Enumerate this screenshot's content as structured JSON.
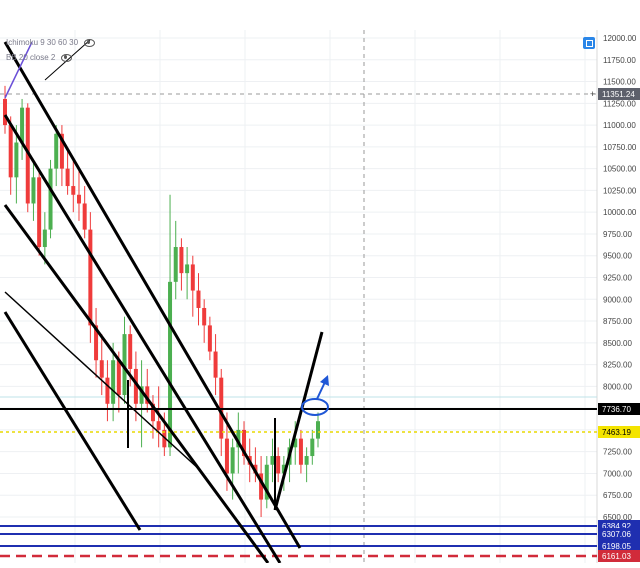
{
  "legend": {
    "ichimoku": "Ichimoku 9 30 60 30",
    "bb": "BB 20 close 2"
  },
  "crosshair_label": "11351.24",
  "chart_data": {
    "type": "candlestick",
    "y_ticks": [
      12000,
      11750,
      11500,
      11250,
      11000,
      10750,
      10500,
      10250,
      10000,
      9750,
      9500,
      9250,
      9000,
      8750,
      8500,
      8250,
      8000,
      7750,
      7500,
      7250,
      7000,
      6750,
      6500
    ],
    "ylim": [
      6150,
      12050
    ],
    "grid": true,
    "price_lines": [
      {
        "label": "7736.70",
        "color": "#000000"
      },
      {
        "label": "7463.19",
        "color": "#e8d800"
      },
      {
        "label": "6384.92",
        "color": "#1f2fb0"
      },
      {
        "label": "6307.06",
        "color": "#1f2fb0"
      },
      {
        "label": "6198.05",
        "color": "#1f2fb0"
      },
      {
        "label": "6161.03",
        "color": "#d12b3a"
      }
    ],
    "candles": [
      [
        11300,
        11450,
        10900,
        11000
      ],
      [
        11000,
        11100,
        10200,
        10400
      ],
      [
        10400,
        11000,
        10100,
        10800
      ],
      [
        10800,
        11300,
        10600,
        11200
      ],
      [
        11200,
        11250,
        10000,
        10100
      ],
      [
        10100,
        10600,
        9900,
        10400
      ],
      [
        10400,
        10500,
        9500,
        9600
      ],
      [
        9600,
        10000,
        9400,
        9800
      ],
      [
        9800,
        10600,
        9700,
        10500
      ],
      [
        10500,
        11000,
        10300,
        10900
      ],
      [
        10900,
        11000,
        10300,
        10500
      ],
      [
        10500,
        10700,
        10200,
        10300
      ],
      [
        10300,
        10600,
        10000,
        10200
      ],
      [
        10200,
        10500,
        9900,
        10100
      ],
      [
        10100,
        10300,
        9700,
        9800
      ],
      [
        9800,
        10000,
        8500,
        8700
      ],
      [
        8700,
        8900,
        8100,
        8300
      ],
      [
        8300,
        8600,
        7900,
        8100
      ],
      [
        8100,
        8300,
        7600,
        7800
      ],
      [
        7800,
        8500,
        7600,
        8300
      ],
      [
        8300,
        8400,
        7700,
        7900
      ],
      [
        7900,
        8800,
        7800,
        8600
      ],
      [
        8600,
        8700,
        8000,
        8200
      ],
      [
        8200,
        8400,
        7600,
        7800
      ],
      [
        7800,
        8300,
        7300,
        8000
      ],
      [
        8000,
        8200,
        7700,
        7800
      ],
      [
        7800,
        7900,
        7400,
        7600
      ],
      [
        7600,
        8000,
        7300,
        7500
      ],
      [
        7500,
        7700,
        7200,
        7300
      ],
      [
        7300,
        10200,
        7200,
        9200
      ],
      [
        9200,
        9900,
        9000,
        9600
      ],
      [
        9600,
        9700,
        9100,
        9300
      ],
      [
        9300,
        9600,
        9000,
        9400
      ],
      [
        9400,
        9500,
        8800,
        9100
      ],
      [
        9100,
        9300,
        8700,
        8900
      ],
      [
        8900,
        9000,
        8500,
        8700
      ],
      [
        8700,
        8800,
        8300,
        8400
      ],
      [
        8400,
        8600,
        7900,
        8100
      ],
      [
        8100,
        8200,
        7200,
        7400
      ],
      [
        7400,
        7700,
        6800,
        7000
      ],
      [
        7000,
        7400,
        6700,
        7300
      ],
      [
        7300,
        7700,
        7000,
        7500
      ],
      [
        7500,
        7600,
        7100,
        7200
      ],
      [
        7200,
        7400,
        6900,
        7100
      ],
      [
        7100,
        7300,
        6900,
        7000
      ],
      [
        7000,
        7200,
        6500,
        6700
      ],
      [
        6700,
        7200,
        6600,
        7100
      ],
      [
        7100,
        7400,
        6900,
        7200
      ],
      [
        7200,
        7300,
        6900,
        7000
      ],
      [
        7000,
        7200,
        6800,
        7100
      ],
      [
        7100,
        7400,
        6900,
        7300
      ],
      [
        7300,
        7600,
        7100,
        7400
      ],
      [
        7400,
        7500,
        7000,
        7100
      ],
      [
        7100,
        7300,
        6900,
        7200
      ],
      [
        7200,
        7500,
        7100,
        7400
      ],
      [
        7400,
        7700,
        7300,
        7600
      ]
    ]
  }
}
